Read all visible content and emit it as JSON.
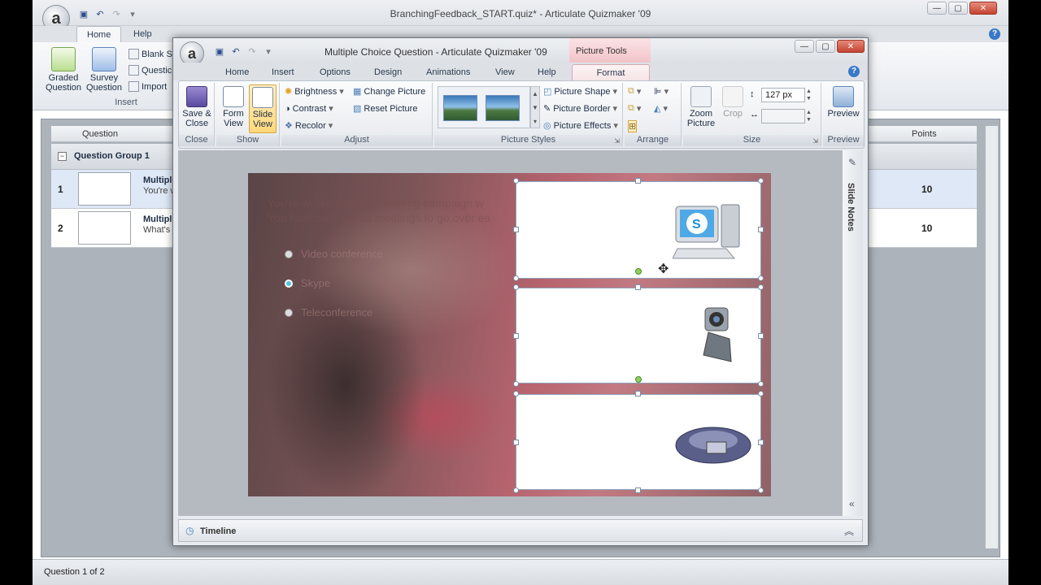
{
  "outer": {
    "title": "BranchingFeedback_START.quiz* - Articulate Quizmaker '09",
    "tabs": [
      "Home",
      "Help"
    ],
    "insert_group": {
      "graded": "Graded Question",
      "survey": "Survey Question",
      "blank": "Blank S",
      "question": "Questic",
      "import": "Import",
      "label": "Insert"
    },
    "list": {
      "col_question": "Question",
      "col_points": "Points",
      "group_label": "Question Group 1",
      "rows": [
        {
          "num": "1",
          "title": "Multipl",
          "sub": "You're w",
          "points": "10"
        },
        {
          "num": "2",
          "title": "Multipl",
          "sub": "What's t",
          "points": "10"
        }
      ]
    },
    "status": "Question 1 of 2"
  },
  "dialog": {
    "title": "Multiple Choice Question - Articulate Quizmaker '09",
    "context_tab": "Picture Tools",
    "tabs": [
      "Home",
      "Insert",
      "Options",
      "Design",
      "Animations",
      "View",
      "Help",
      "Format"
    ],
    "close_group": {
      "save_close": "Save & Close",
      "label": "Close"
    },
    "show_group": {
      "form_view": "Form View",
      "slide_view": "Slide View",
      "label": "Show"
    },
    "adjust_group": {
      "brightness": "Brightness",
      "contrast": "Contrast",
      "recolor": "Recolor",
      "change_picture": "Change Picture",
      "reset_picture": "Reset Picture",
      "label": "Adjust"
    },
    "styles_group": {
      "shape": "Picture Shape",
      "border": "Picture Border",
      "effects": "Picture Effects",
      "label": "Picture Styles"
    },
    "arrange_group": {
      "label": "Arrange"
    },
    "size_group": {
      "zoom": "Zoom Picture",
      "crop": "Crop",
      "width_value": "127 px",
      "label": "Size"
    },
    "preview_group": {
      "preview": "Preview",
      "label": "Preview"
    },
    "slide": {
      "question_line1": "You're working on a marketing campaign w",
      "question_line2": "You host daily status meetings to go over ea",
      "choices": [
        "Video conference",
        "Skype",
        "Teleconference"
      ]
    },
    "slide_notes": "Slide Notes",
    "timeline": "Timeline"
  }
}
